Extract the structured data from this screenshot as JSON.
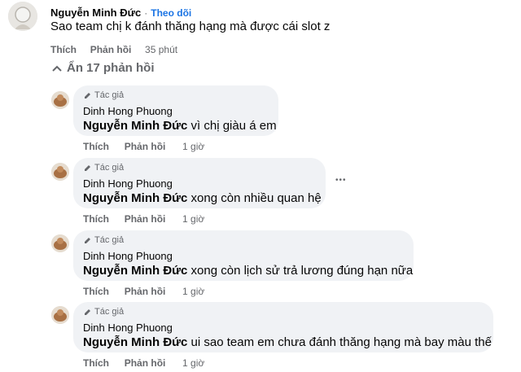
{
  "top_comment": {
    "author": "Nguyễn Minh Đức",
    "separator": "·",
    "follow": "Theo dõi",
    "text": "Sao team chị k đánh thăng hạng mà được cái slot z",
    "like": "Thích",
    "reply": "Phản hồi",
    "time": "35 phút"
  },
  "hide_replies": {
    "label": "Ẩn 17 phản hồi",
    "icon": "chevron-up-icon"
  },
  "replies": [
    {
      "badge": "Tác giả",
      "author": "Dinh Hong Phuong",
      "mention": "Nguyễn Minh Đức",
      "text": " vì chị giàu á em",
      "like": "Thích",
      "reply": "Phản hồi",
      "time": "1 giờ"
    },
    {
      "badge": "Tác giả",
      "author": "Dinh Hong Phuong",
      "mention": "Nguyễn Minh Đức",
      "text": " xong còn nhiều quan hệ",
      "like": "Thích",
      "reply": "Phản hồi",
      "time": "1 giờ",
      "more": "•••"
    },
    {
      "badge": "Tác giả",
      "author": "Dinh Hong Phuong",
      "mention": "Nguyễn Minh Đức",
      "text": " xong còn lịch sử trả lương đúng hạn nữa",
      "like": "Thích",
      "reply": "Phản hồi",
      "time": "1 giờ"
    },
    {
      "badge": "Tác giả",
      "author": "Dinh Hong Phuong",
      "mention": "Nguyễn Minh Đức",
      "text": " ui sao team em chưa đánh thăng hạng mà bay màu thế",
      "like": "Thích",
      "reply": "Phản hồi",
      "time": "1 giờ"
    }
  ]
}
